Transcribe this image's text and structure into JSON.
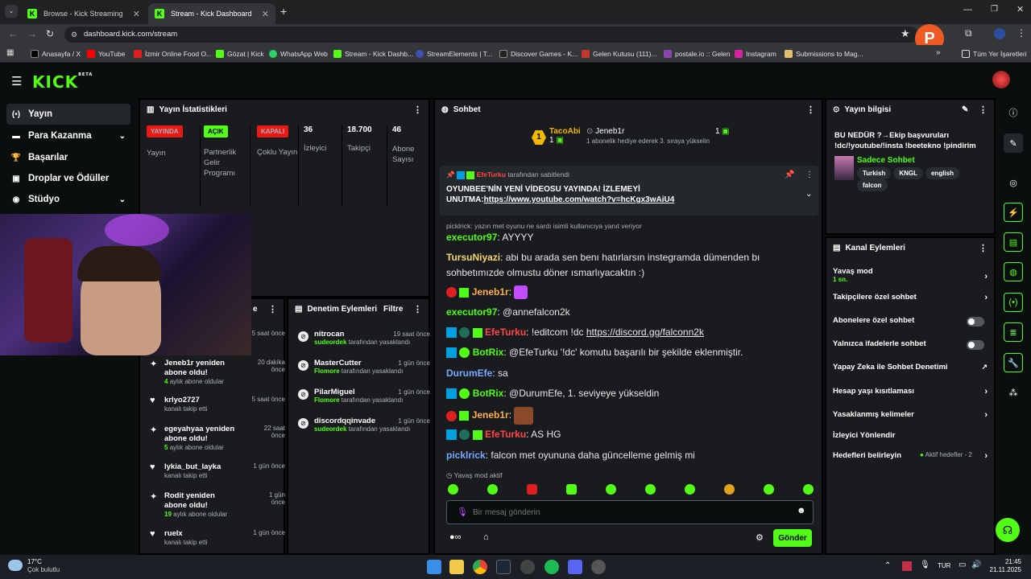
{
  "browser": {
    "tabs": [
      {
        "label": "Browse - Kick Streaming"
      },
      {
        "label": "Stream - Kick Dashboard"
      }
    ],
    "new_tab": "+",
    "url": "dashboard.kick.com/stream",
    "bookmarks": [
      "Anasayfa / X",
      "YouTube",
      "İzmir Online Food O...",
      "Gözat | Kick",
      "WhatsApp Web",
      "Stream - Kick Dashb...",
      "StreamElements | T...",
      "Discover Games - K...",
      "Gelen Kutusu (111)...",
      "postale.io :: Gelen",
      "Instagram",
      "Submissions to Mag..."
    ],
    "all_bookmarks": "Tüm Yer İşaretleri",
    "profile_letter": "P"
  },
  "app": {
    "logo": "KICK",
    "logo_sup": "BETA"
  },
  "sidebar": {
    "items": [
      {
        "label": "Yayın"
      },
      {
        "label": "Para Kazanma"
      },
      {
        "label": "Başarılar"
      },
      {
        "label": "Droplar ve Ödüller"
      },
      {
        "label": "Stüdyo"
      }
    ]
  },
  "stats": {
    "title": "Yayın İstatistikleri",
    "cols": [
      {
        "badge": "YAYINDA",
        "label": "Yayın",
        "color": "#e91916"
      },
      {
        "badge": "AÇIK",
        "label": "Partnerlik Gelir Programı",
        "color": "#53fc18"
      },
      {
        "badge": "KAPALI",
        "label": "Çoklu Yayın",
        "color": "#e91916"
      },
      {
        "value": "36",
        "label": "İzleyici"
      },
      {
        "value": "18.700",
        "label": "Takipçi"
      },
      {
        "value": "46",
        "label": "Abone Sayısı"
      }
    ]
  },
  "activity": {
    "title": "e",
    "items": [
      {
        "name": "",
        "sub": "",
        "time": "5 saat önce"
      },
      {
        "name": "Jeneb1r yeniden abone oldu!",
        "num": "4",
        "sub": "aylık abone oldular",
        "time": "20 dakika önce"
      },
      {
        "name": "krlyo2727",
        "sub": "kanalı takip etti",
        "time": "5 saat önce"
      },
      {
        "name": "egeyahyaa yeniden abone oldu!",
        "num": "5",
        "sub": "aylık abone oldular",
        "time": "22 saat önce"
      },
      {
        "name": "lykia_but_layka",
        "sub": "kanalı takip etti",
        "time": "1 gün önce"
      },
      {
        "name": "Rodit yeniden abone oldu!",
        "num": "19",
        "sub": "aylık abone oldular",
        "time": "1 gün önce"
      },
      {
        "name": "ruelx",
        "sub": "kanalı takip etti",
        "time": "1 gün önce"
      }
    ]
  },
  "moderation": {
    "title": "Denetim Eylemleri",
    "filter": "Filtre",
    "items": [
      {
        "name": "nitrocan",
        "by": "sudeordek",
        "sub": "tarafından yasaklandı",
        "time": "19 saat önce"
      },
      {
        "name": "MasterCutter",
        "by": "Flomore",
        "sub": "tarafından yasaklandı",
        "time": "1 gün önce"
      },
      {
        "name": "PilarMiguel",
        "by": "Flomore",
        "sub": "tarafından yasaklandı",
        "time": "1 gün önce"
      },
      {
        "name": "discordqqinvade",
        "by": "sudeordek",
        "sub": "tarafından yasaklandı",
        "time": "1 gün önce"
      }
    ]
  },
  "chat": {
    "title": "Sohbet",
    "leader1": {
      "name": "TacoAbi",
      "count": "1",
      "rank": "1"
    },
    "leader2": {
      "name": "Jeneb1r",
      "count": "1",
      "note": "1 abonelik hediye ederek 3. sıraya yükselin"
    },
    "pinned": {
      "by": "EfeTurku",
      "by_suffix": "tarafından sabitlendi",
      "text": "OYUNBEE'NİN YENİ VİDEOSU YAYINDA! İZLEMEYİ UNUTMA:",
      "link": "https://www.youtube.com/watch?v=hcKgx3wAiU4"
    },
    "reply_note": "picklrick: yazın met oyunu ne sardı isimli kullanıcıya yanıt veriyor",
    "messages": [
      {
        "user": "executor97",
        "text": "AYYYY",
        "color": "#53fc18"
      },
      {
        "user": "TursuNiyazi",
        "text": "abi bu arada sen benı hatırlarsın instegramda dümenden bı sohbetımızde olmustu döner ısmarlıyacaktın :)",
        "color": "#f8d66d"
      },
      {
        "user": "Jeneb1r",
        "text": "",
        "color": "#ffad45"
      },
      {
        "user": "executor97",
        "text": "@annefalcon2k",
        "color": "#53fc18"
      },
      {
        "user": "EfeTurku",
        "text": "!editcom !dc ",
        "link": "https://discord.gg/falconn2k",
        "color": "#ff4747"
      },
      {
        "user": "BotRix",
        "text": "@EfeTurku '!dc' komutu başarılı bir şekilde eklenmiştir.",
        "color": "#53fc18"
      },
      {
        "user": "DurumEfe",
        "text": "sa",
        "color": "#78a9ff"
      },
      {
        "user": "BotRix",
        "text": "@DurumEfe, 1. seviyeye yükseldin",
        "color": "#53fc18"
      },
      {
        "user": "Jeneb1r",
        "text": "",
        "color": "#ffad45"
      },
      {
        "user": "EfeTurku",
        "text": "AS HG",
        "color": "#ff4747"
      },
      {
        "user": "picklrick",
        "text": "falcon met oyununa daha güncelleme gelmiş mi",
        "color": "#78a9ff"
      }
    ],
    "slow_mode": "Yavaş mod aktif",
    "input_placeholder": "Bir mesaj gönderin",
    "send": "Gönder"
  },
  "stream_info": {
    "title": "Yayın bilgisi",
    "stream_title": "BU NEDÜR ?→Ekip başvuruları !dc/!youtube/!insta !beetekno !pindirim",
    "category": "Sadece Sohbet",
    "tags": [
      "Turkish",
      "KNGL",
      "english",
      "falcon"
    ]
  },
  "channel_actions": {
    "title": "Kanal Eylemleri",
    "rows": [
      {
        "label": "Yavaş mod",
        "sub": "1 sn.",
        "control": "arrow"
      },
      {
        "label": "Takipçilere özel sohbet",
        "control": "arrow"
      },
      {
        "label": "Abonelere özel sohbet",
        "control": "toggle"
      },
      {
        "label": "Yalnızca ifadelerle sohbet",
        "control": "toggle"
      },
      {
        "label": "Yapay Zeka ile Sohbet Denetimi",
        "control": "ext"
      },
      {
        "label": "Hesap yaşı kısıtlaması",
        "control": "arrow"
      },
      {
        "label": "Yasaklanmış kelimeler",
        "control": "arrow"
      },
      {
        "label": "İzleyici Yönlendir",
        "control": "none"
      },
      {
        "label": "Hedefleri belirleyin",
        "control": "arrow",
        "extra": "Aktif hedefler - 2"
      }
    ]
  },
  "taskbar": {
    "temp": "17°C",
    "weather": "Çok bulutlu",
    "lang": "TUR",
    "time": "21:45",
    "date": "21.11.2025"
  }
}
